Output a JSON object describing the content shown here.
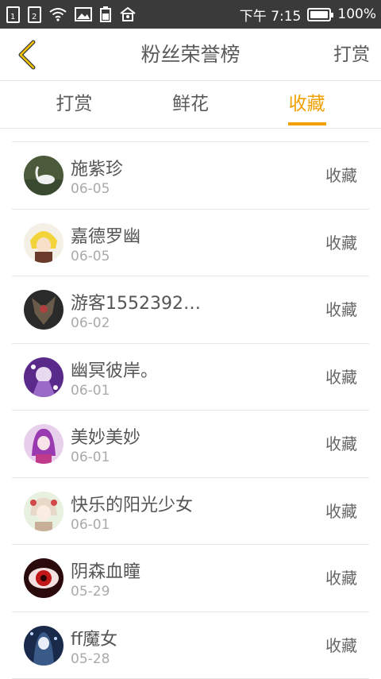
{
  "status_bar": {
    "sim1": "1",
    "sim2": "2",
    "time": "下午 7:15",
    "battery": "100%",
    "icons": [
      "sim1-icon",
      "sim2-icon",
      "wifi-icon",
      "image-icon",
      "battery-small-icon",
      "home-icon",
      "battery-icon"
    ]
  },
  "header": {
    "title": "粉丝荣誉榜",
    "action": "打赏",
    "back_icon": "chevron-left-icon"
  },
  "tabs": [
    {
      "label": "打赏"
    },
    {
      "label": "鲜花"
    },
    {
      "label": "收藏",
      "active": true
    }
  ],
  "colors": {
    "accent": "#f0a000",
    "statusbar": "#3a3a3a"
  },
  "list": [
    {
      "name": "施紫珍",
      "date": "06-05",
      "type": "收藏"
    },
    {
      "name": "嘉德罗幽",
      "date": "06-05",
      "type": "收藏"
    },
    {
      "name": "游客1552392…",
      "date": "06-02",
      "type": "收藏"
    },
    {
      "name": "幽冥彼岸。",
      "date": "06-01",
      "type": "收藏"
    },
    {
      "name": "美妙美妙",
      "date": "06-01",
      "type": "收藏"
    },
    {
      "name": "快乐的阳光少女",
      "date": "06-01",
      "type": "收藏"
    },
    {
      "name": "阴森血瞳",
      "date": "05-29",
      "type": "收藏"
    },
    {
      "name": "ff魔女",
      "date": "05-28",
      "type": "收藏"
    }
  ]
}
